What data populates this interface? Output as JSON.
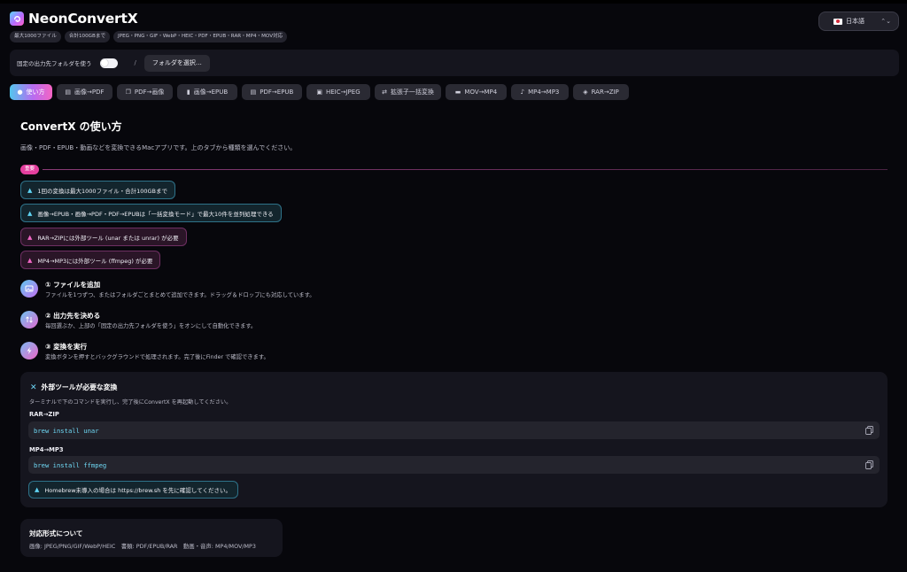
{
  "app": {
    "title": "NeonConvertX",
    "badges": [
      "最大1000ファイル",
      "合計100GBまで",
      "JPEG・PNG・GIF・WebP・HEIC・PDF・EPUB・RAR・MP4・MOV対応"
    ],
    "language": "日本語"
  },
  "output": {
    "fixed_label": "固定の出力先フォルダを使う",
    "separator": "/",
    "choose_label": "フォルダを選択…"
  },
  "tabs": [
    {
      "label": "使い方",
      "icon": "question-icon",
      "active": true
    },
    {
      "label": "画像→PDF",
      "icon": "document-icon"
    },
    {
      "label": "PDF→画像",
      "icon": "pages-icon"
    },
    {
      "label": "画像→EPUB",
      "icon": "book-icon"
    },
    {
      "label": "PDF→EPUB",
      "icon": "document-icon"
    },
    {
      "label": "HEIC→JPEG",
      "icon": "photo-icon"
    },
    {
      "label": "拡張子一括変換",
      "icon": "sparkle-icon"
    },
    {
      "label": "MOV→MP4",
      "icon": "film-icon"
    },
    {
      "label": "MP4→MP3",
      "icon": "music-note-icon"
    },
    {
      "label": "RAR→ZIP",
      "icon": "box-icon"
    }
  ],
  "main": {
    "title": "ConvertX の使い方",
    "description": "画像・PDF・EPUB・動画などを変換できるMacアプリです。上のタブから種類を選んでください。",
    "important_tag": "重要"
  },
  "notices": [
    {
      "text": "1回の変換は最大1000ファイル・合計100GBまで",
      "tone": "cyan"
    },
    {
      "text": "画像→EPUB・画像→PDF・PDF→EPUBは「一括変換モード」で最大10件を並列処理できる",
      "tone": "cyan"
    },
    {
      "text": "RAR→ZIPには外部ツール (unar または unrar) が必要",
      "tone": "pink"
    },
    {
      "text": "MP4→MP3には外部ツール (ffmpeg) が必要",
      "tone": "pink"
    }
  ],
  "steps": [
    {
      "title": "① ファイルを追加",
      "desc": "ファイルを1つずつ、またはフォルダごとまとめて追加できます。ドラッグ＆ドロップにも対応しています。",
      "icon": "image-add-icon"
    },
    {
      "title": "② 出力先を決める",
      "desc": "毎回選ぶか、上部の「固定の出力先フォルダを使う」をオンにして自動化できます。",
      "icon": "arrows-updown-icon"
    },
    {
      "title": "③ 変換を実行",
      "desc": "変換ボタンを押すとバックグラウンドで処理されます。完了後にFinder で確認できます。",
      "icon": "bolt-icon"
    }
  ],
  "tools": {
    "title": "外部ツールが必要な変換",
    "desc": "ターミナルで下のコマンドを実行し、完了後にConvertX を再起動してください。",
    "items": [
      {
        "label": "RAR→ZIP",
        "command": "brew install unar"
      },
      {
        "label": "MP4→MP3",
        "command": "brew install ffmpeg"
      }
    ],
    "notice": "Homebrew未導入の場合は https://brew.sh を先に確認してください。"
  },
  "formats": {
    "title": "対応形式について",
    "text": "画像: JPEG/PNG/GIF/WebP/HEIC　書類: PDF/EPUB/RAR　動画・音声: MP4/MOV/MP3"
  },
  "colors": {
    "background": "#07070c",
    "card": "#15151e",
    "accent_cyan": "#5fd3f2",
    "accent_pink": "#f067c4",
    "accent_purple": "#b86cf0"
  }
}
